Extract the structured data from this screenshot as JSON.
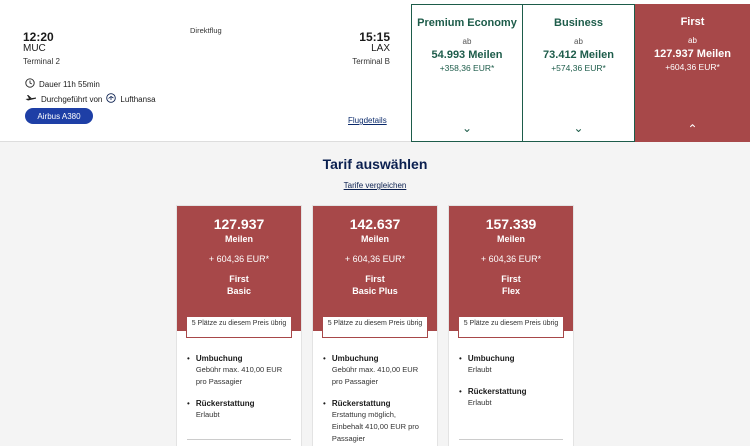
{
  "flight": {
    "dep_time": "12:20",
    "arr_time": "15:15",
    "type": "Direktflug",
    "dep_code": "MUC",
    "arr_code": "LAX",
    "dep_terminal": "Terminal 2",
    "arr_terminal": "Terminal B",
    "duration": "Dauer 11h 55min",
    "operated_by": "Durchgeführt von",
    "airline": "Lufthansa",
    "aircraft": "Airbus A380",
    "details_link": "Flugdetails"
  },
  "cabins": [
    {
      "name": "Premium Economy",
      "ab": "ab",
      "miles": "54.993 Meilen",
      "eur": "+358,36 EUR*",
      "chevron": "⌄"
    },
    {
      "name": "Business",
      "ab": "ab",
      "miles": "73.412 Meilen",
      "eur": "+574,36 EUR*",
      "chevron": "⌄"
    },
    {
      "name": "First",
      "ab": "ab",
      "miles": "127.937 Meilen",
      "eur": "+604,36 EUR*",
      "chevron": "⌃"
    }
  ],
  "tarif": {
    "title": "Tarif auswählen",
    "compare": "Tarife vergleichen"
  },
  "fares": [
    {
      "miles": "127.937",
      "unit": "Meilen",
      "eur": "+ 604,36 EUR*",
      "class": "First",
      "tariff": "Basic",
      "availability": "5 Plätze zu diesem Preis übrig",
      "features": [
        {
          "title": "Umbuchung",
          "text": "Gebühr max. 410,00 EUR pro Passagier"
        },
        {
          "title": "Rückerstattung",
          "text": "Erlaubt"
        }
      ]
    },
    {
      "miles": "142.637",
      "unit": "Meilen",
      "eur": "+ 604,36 EUR*",
      "class": "First",
      "tariff": "Basic Plus",
      "availability": "5 Plätze zu diesem Preis übrig",
      "features": [
        {
          "title": "Umbuchung",
          "text": "Gebühr max. 410,00 EUR pro Passagier"
        },
        {
          "title": "Rückerstattung",
          "text": "Erstattung möglich, Einbehalt 410,00 EUR pro Passagier"
        }
      ]
    },
    {
      "miles": "157.339",
      "unit": "Meilen",
      "eur": "+ 604,36 EUR*",
      "class": "First",
      "tariff": "Flex",
      "availability": "5 Plätze zu diesem Preis übrig",
      "features": [
        {
          "title": "Umbuchung",
          "text": "Erlaubt"
        },
        {
          "title": "Rückerstattung",
          "text": "Erlaubt"
        }
      ]
    }
  ],
  "colors": {
    "first_red": "#a74849",
    "cabin_green": "#1d5c4a",
    "navy": "#0a1f4f",
    "aircraft_blue": "#1e3fa6"
  },
  "icons": {
    "duration": "clock-icon",
    "operated": "plane-icon",
    "airline": "crane-logo-icon"
  }
}
